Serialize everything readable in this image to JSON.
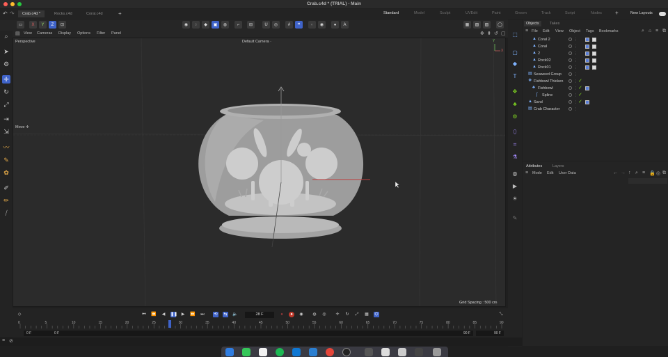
{
  "window": {
    "title": "Crab.c4d * (TRIAL) - Main"
  },
  "doc_tabs": [
    {
      "label": "Crab.c4d *",
      "active": true
    },
    {
      "label": "Rocks.c4d",
      "active": false
    },
    {
      "label": "Coral.c4d",
      "active": false
    }
  ],
  "add_tab_label": "+",
  "layouts": [
    {
      "label": "Standard",
      "active": true
    },
    {
      "label": "Model",
      "active": false
    },
    {
      "label": "Sculpt",
      "active": false
    },
    {
      "label": "UVEdit",
      "active": false
    },
    {
      "label": "Paint",
      "active": false
    },
    {
      "label": "Groom",
      "active": false
    },
    {
      "label": "Track",
      "active": false
    },
    {
      "label": "Script",
      "active": false
    },
    {
      "label": "Nodes",
      "active": false
    }
  ],
  "new_layouts_label": "New Layouts",
  "viewport_menu": [
    "View",
    "Cameras",
    "Display",
    "Options",
    "Filter",
    "Panel"
  ],
  "viewport": {
    "projection_label": "Perspective",
    "camera_label": "Default Camera",
    "camera_icon": "·",
    "tool_hint": "Move",
    "tool_hint_icon": "✛",
    "grid_spacing": "Grid Spacing : 500 cm",
    "axis_y": "Y",
    "axis_x": "X"
  },
  "timeline": {
    "ruler": [
      "0",
      "5",
      "10",
      "15",
      "20",
      "25",
      "30",
      "35",
      "40",
      "45",
      "50",
      "55",
      "60",
      "65",
      "70",
      "75",
      "80",
      "85",
      "90"
    ],
    "current_frame": "28 F",
    "start_frame": "0 F",
    "min_frame": "0 F",
    "max_frame": "90 F",
    "end_frame": "90 F",
    "playhead_frame": 28
  },
  "object_manager": {
    "tabs": [
      {
        "label": "Objects",
        "active": true
      },
      {
        "label": "Takes",
        "active": false
      }
    ],
    "menu": [
      "File",
      "Edit",
      "View",
      "Object",
      "Tags",
      "Bookmarks"
    ],
    "objects": [
      {
        "name": "Coral 2",
        "indent": 1,
        "icon": "▲",
        "tags": "double"
      },
      {
        "name": "Coral",
        "indent": 1,
        "icon": "▲",
        "tags": "double"
      },
      {
        "name": "2",
        "indent": 1,
        "icon": "▲",
        "tags": "double"
      },
      {
        "name": "Rock02",
        "indent": 1,
        "icon": "▲",
        "tags": "double"
      },
      {
        "name": "Rock01",
        "indent": 1,
        "icon": "▲",
        "tags": "double"
      },
      {
        "name": "Seaweed Group",
        "indent": 0,
        "icon": "▤",
        "tags": "none"
      },
      {
        "name": "Fishbowl Thicken",
        "indent": 0,
        "icon": "❖",
        "tags": "check"
      },
      {
        "name": "Fishbowl",
        "indent": 1,
        "icon": "♣",
        "tags": "check-tag"
      },
      {
        "name": "Spline",
        "indent": 2,
        "icon": "ʃ",
        "tags": "check"
      },
      {
        "name": "Sand",
        "indent": 0,
        "icon": "▲",
        "tags": "check-tag"
      },
      {
        "name": "Crab Character",
        "indent": 0,
        "icon": "▤",
        "tags": "none"
      }
    ]
  },
  "attributes": {
    "tabs": [
      {
        "label": "Attributes",
        "active": true
      },
      {
        "label": "Layers",
        "active": false
      }
    ],
    "menu": [
      "Mode",
      "Edit",
      "User Data"
    ]
  },
  "colors": {
    "accent": "#3f63c9",
    "check": "#7ed321",
    "bg": "#1f1f1f"
  }
}
